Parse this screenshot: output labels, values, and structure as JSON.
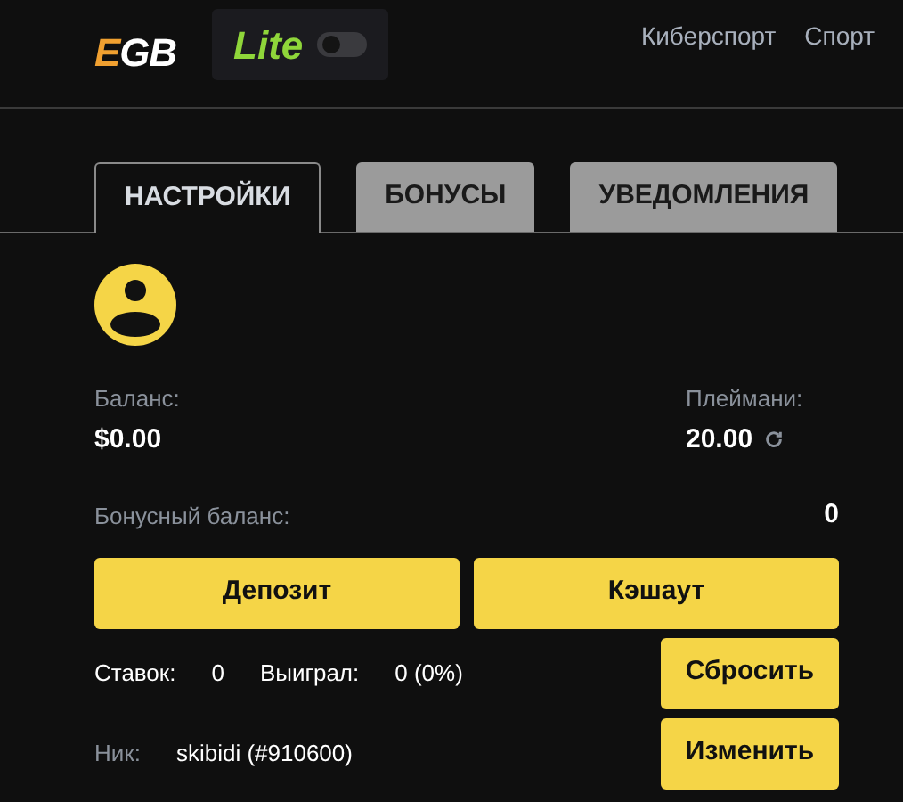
{
  "header": {
    "logo": {
      "accent": "E",
      "rest": "GB"
    },
    "lite": {
      "label": "Lite",
      "on": false
    },
    "nav": [
      "Киберспорт",
      "Спорт"
    ]
  },
  "tabs": [
    {
      "label": "НАСТРОЙКИ",
      "selected": true
    },
    {
      "label": "БОНУСЫ",
      "selected": false
    },
    {
      "label": "УВЕДОМЛЕНИЯ",
      "selected": false
    }
  ],
  "balance": {
    "label": "Баланс:",
    "value": "$0.00"
  },
  "playmoney": {
    "label": "Плеймани:",
    "value": "20.00"
  },
  "bonus_balance": {
    "label": "Бонусный баланс:",
    "value": "0"
  },
  "buttons": [
    "Депозит",
    "Кэшаут"
  ],
  "stats": {
    "bets_label": "Ставок:",
    "bets": "0",
    "won_label": "Выиграл:",
    "won": "0 (0%)",
    "reset": "Сбросить"
  },
  "nick": {
    "label": "Ник:",
    "value": "skibidi (#910600)",
    "change": "Изменить"
  }
}
